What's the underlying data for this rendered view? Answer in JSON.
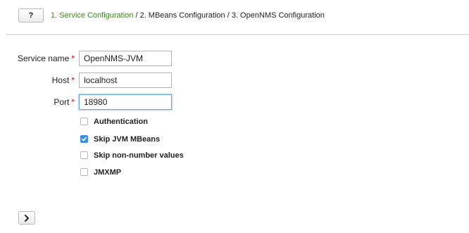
{
  "header": {
    "help_label": "?",
    "steps": {
      "step1": "1. Service Configuration",
      "sep1": " / ",
      "step2": "2. MBeans Configuration",
      "sep2": " / ",
      "step3": "3. OpenNMS Configuration"
    }
  },
  "form": {
    "service_name": {
      "label": "Service name",
      "required_mark": "*",
      "value": "OpenNMS-JVM"
    },
    "host": {
      "label": "Host",
      "required_mark": "*",
      "value": "localhost"
    },
    "port": {
      "label": "Port",
      "required_mark": "*",
      "value": "18980"
    }
  },
  "options": {
    "authentication": {
      "label": "Authentication",
      "checked": false
    },
    "skip_jvm_mbeans": {
      "label": "Skip JVM MBeans",
      "checked": true
    },
    "skip_non_number": {
      "label": "Skip non-number values",
      "checked": false
    },
    "jmxmp": {
      "label": "JMXMP",
      "checked": false
    }
  },
  "footer": {
    "next_icon": "chevron-right-icon"
  },
  "colors": {
    "active_step": "#3c8a1f",
    "required": "#d0021b",
    "checkbox_checked": "#3a8ee6",
    "focus_border": "#6aa2dc"
  }
}
